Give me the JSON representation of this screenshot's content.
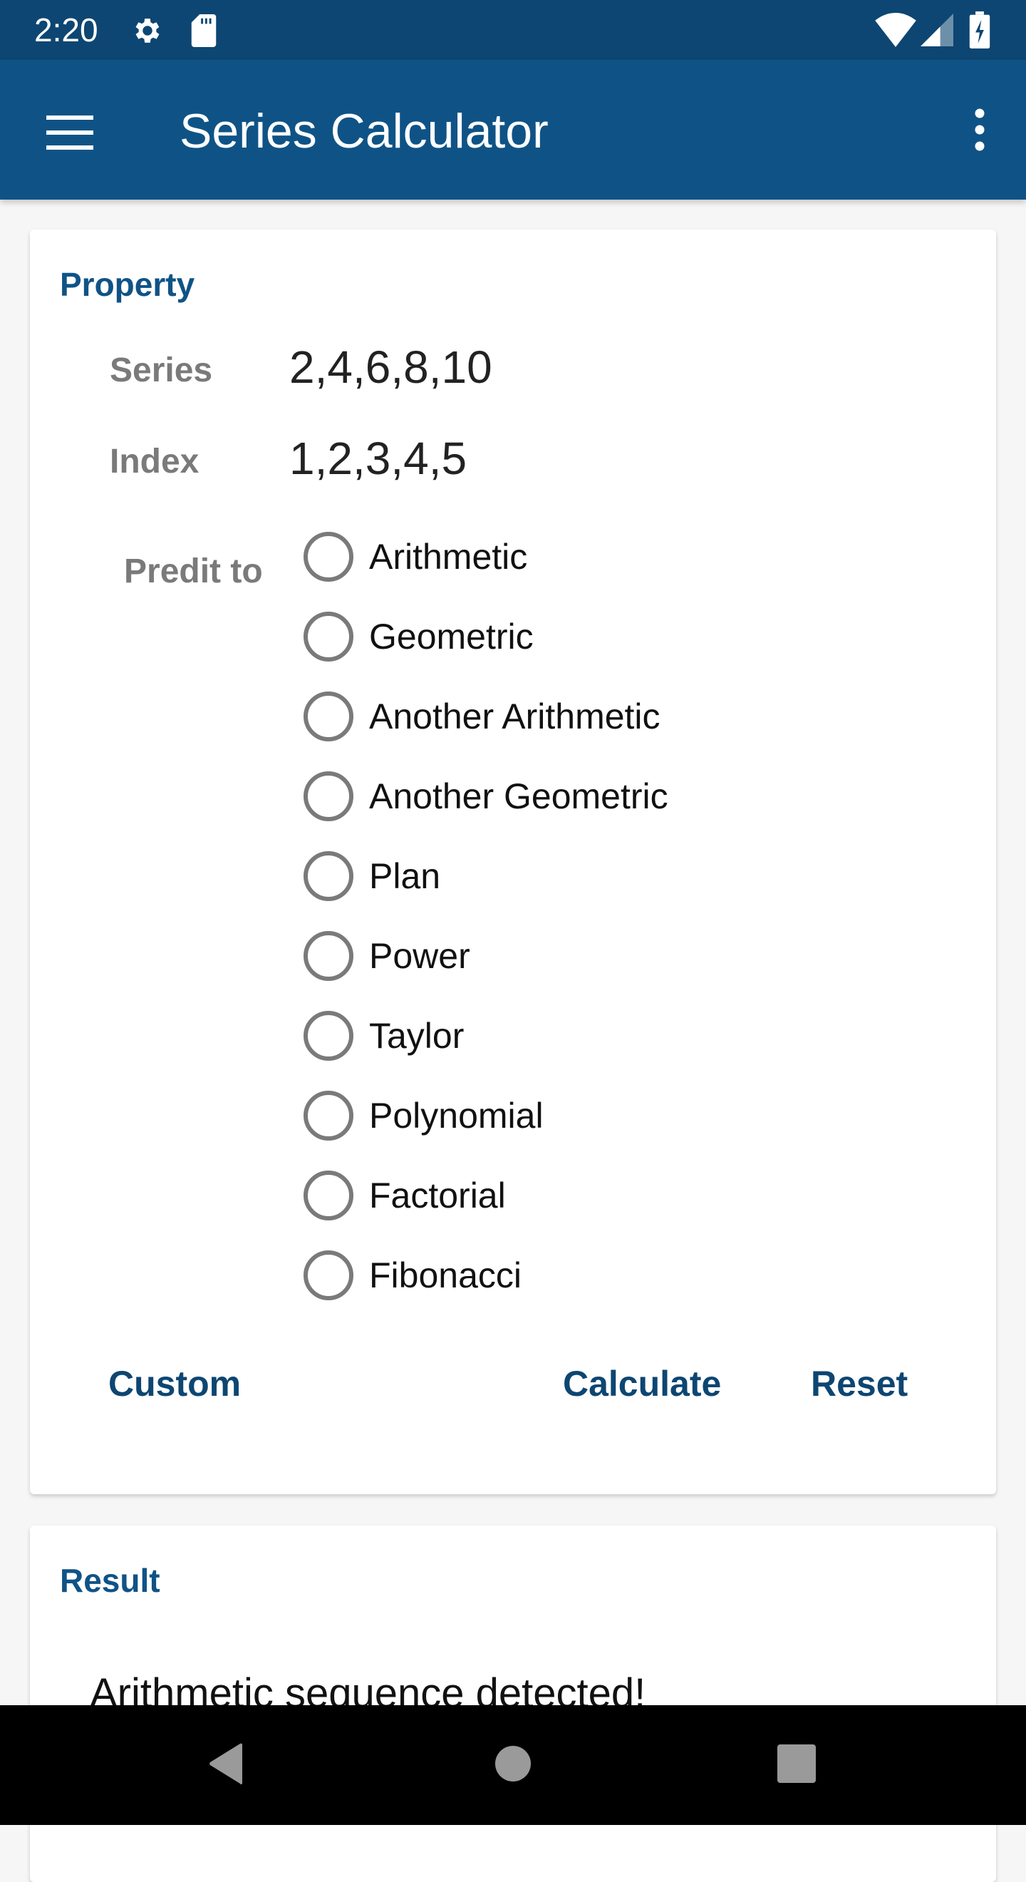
{
  "status_bar": {
    "time": "2:20",
    "left_icons": [
      "gear-icon",
      "sd-card-icon"
    ],
    "right_icons": [
      "wifi-icon",
      "cell-signal-icon",
      "battery-charging-icon"
    ]
  },
  "app_bar": {
    "title": "Series Calculator",
    "menu_icon": "hamburger-menu-icon",
    "overflow_icon": "more-vert-icon"
  },
  "property_card": {
    "title": "Property",
    "series_label": "Series",
    "series_value": "2,4,6,8,10",
    "index_label": "Index",
    "index_value": "1,2,3,4,5",
    "predict_label": "Predit to",
    "options": [
      {
        "label": "Arithmetic",
        "selected": false
      },
      {
        "label": "Geometric",
        "selected": false
      },
      {
        "label": "Another Arithmetic",
        "selected": false
      },
      {
        "label": "Another Geometric",
        "selected": false
      },
      {
        "label": "Plan",
        "selected": false
      },
      {
        "label": "Power",
        "selected": false
      },
      {
        "label": "Taylor",
        "selected": false
      },
      {
        "label": "Polynomial",
        "selected": false
      },
      {
        "label": "Factorial",
        "selected": false
      },
      {
        "label": "Fibonacci",
        "selected": false
      }
    ],
    "buttons": {
      "custom": "Custom",
      "calculate": "Calculate",
      "reset": "Reset"
    }
  },
  "result_card": {
    "title": "Result",
    "text": "Arithmetic sequence detected!"
  },
  "colors": {
    "primary": "#0f5386",
    "primary_dark": "#0d4672",
    "label_gray": "#7a7a7a"
  }
}
